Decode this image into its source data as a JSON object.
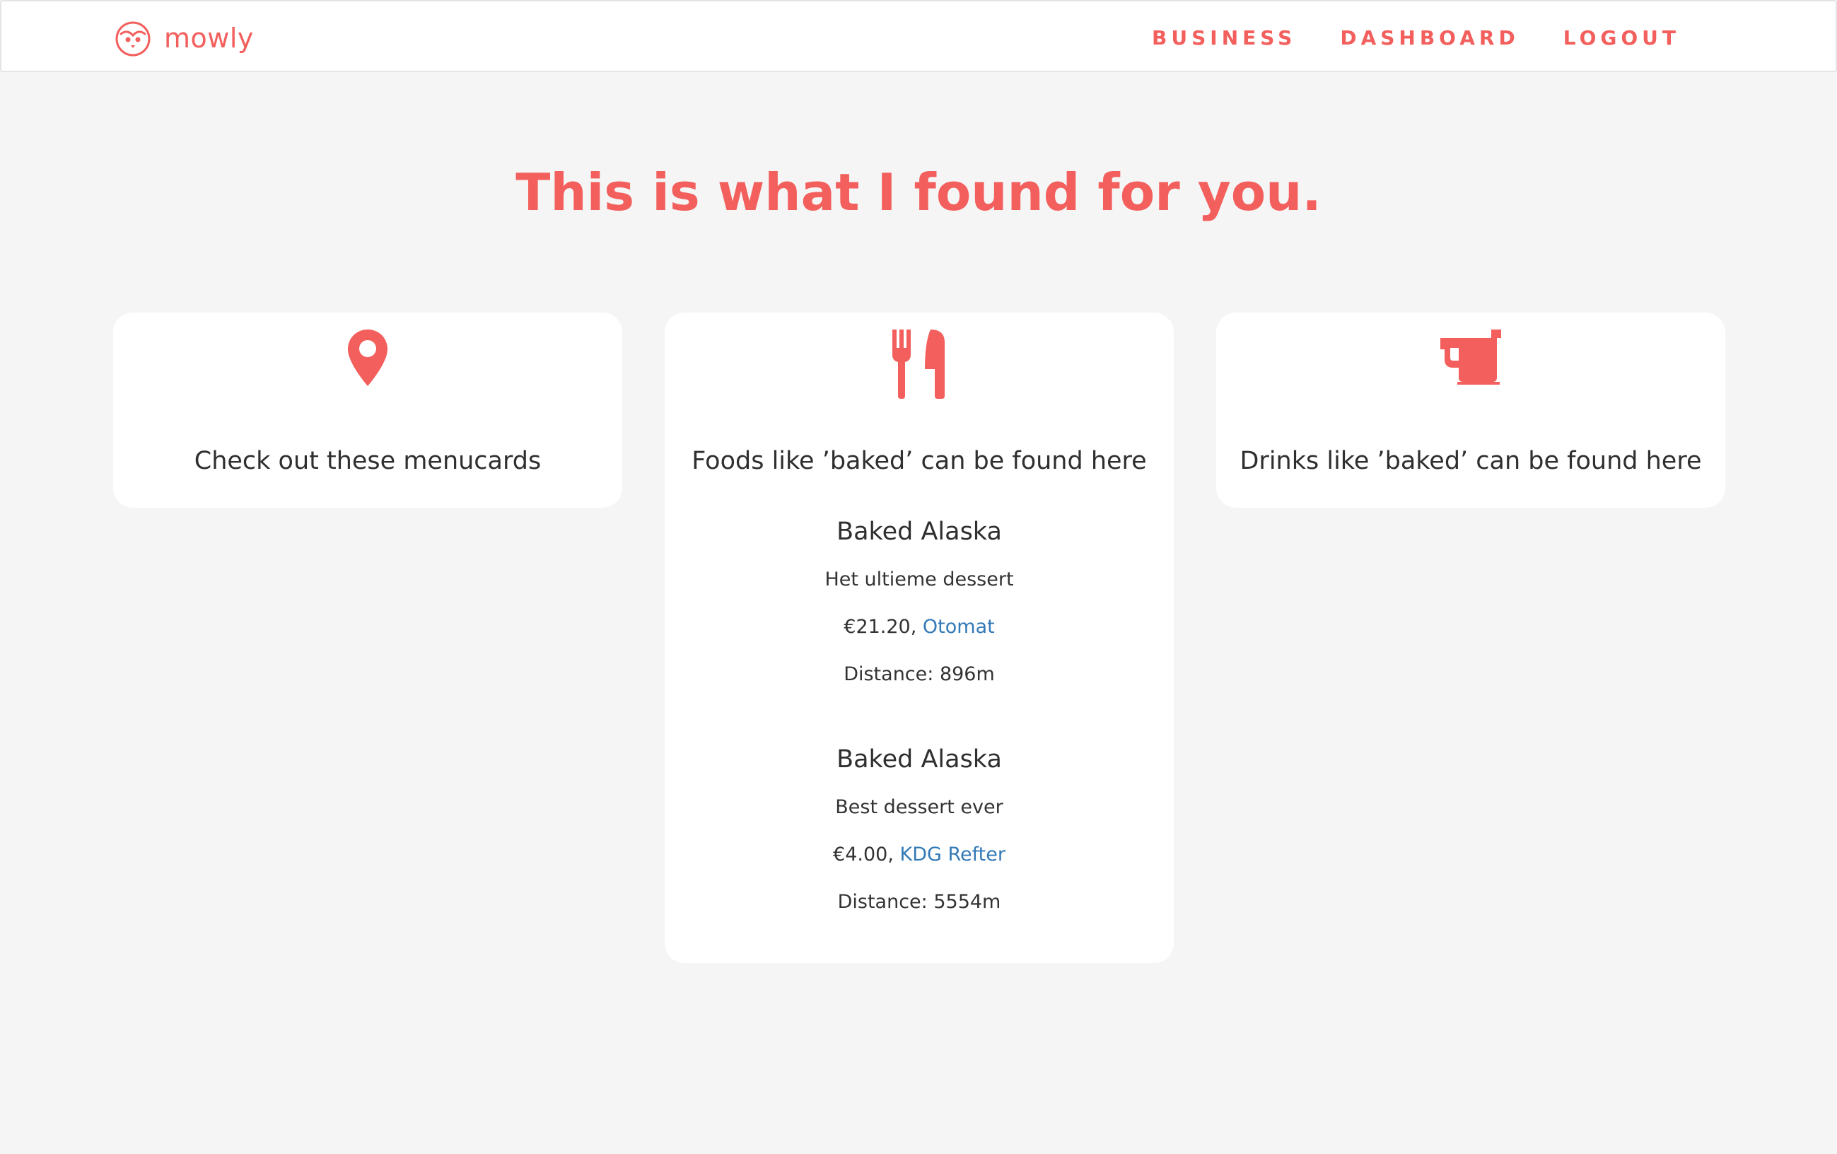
{
  "brand": {
    "name": "mowly",
    "icon": "owl-icon"
  },
  "nav": [
    {
      "label": "BUSINESS"
    },
    {
      "label": "DASHBOARD"
    },
    {
      "label": "LOGOUT"
    }
  ],
  "page_title": "This is what I found for you.",
  "accent_color": "#f25f5c",
  "link_color": "#337ab7",
  "cards": {
    "menucards": {
      "icon": "map-pin-icon",
      "heading": "Check out these menucards"
    },
    "foods": {
      "icon": "fork-knife-icon",
      "heading": "Foods like ’baked’ can be found here",
      "items": [
        {
          "name": "Baked Alaska",
          "description": "Het ultieme dessert",
          "price": "€21.20",
          "separator": ", ",
          "venue": "Otomat",
          "distance": "Distance: 896m"
        },
        {
          "name": "Baked Alaska",
          "description": "Best dessert ever",
          "price": "€4.00",
          "separator": ", ",
          "venue": "KDG Refter",
          "distance": "Distance: 5554m"
        }
      ]
    },
    "drinks": {
      "icon": "mug-icon",
      "heading": "Drinks like ’baked’ can be found here"
    }
  }
}
